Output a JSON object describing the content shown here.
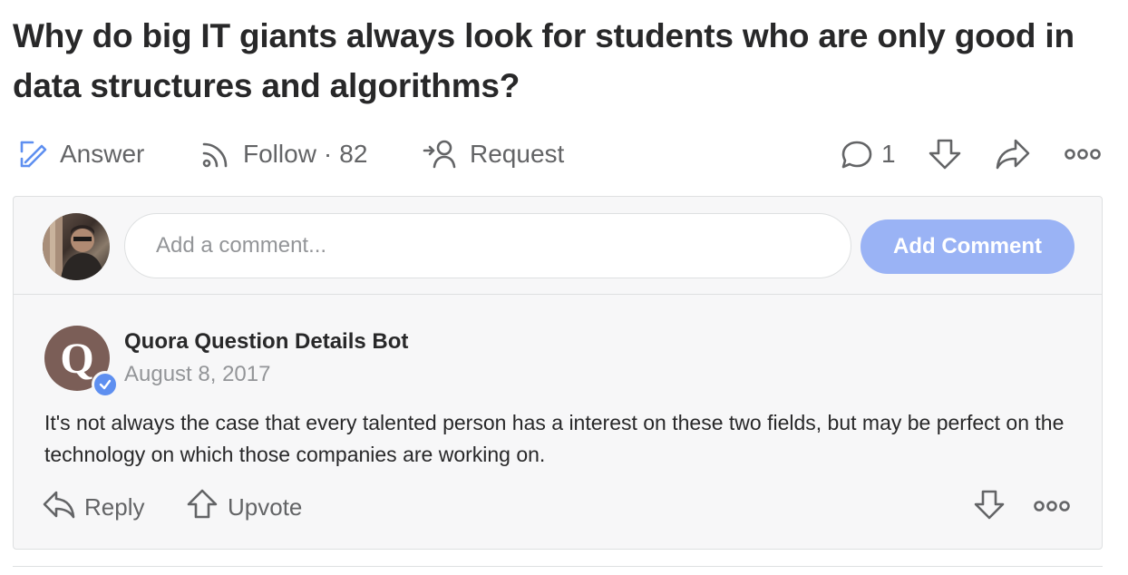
{
  "question": {
    "title": "Why do big IT giants always look for students who are only good in data structures and algorithms?"
  },
  "actions": {
    "answer_label": "Answer",
    "follow_label": "Follow",
    "follow_separator": "·",
    "follow_count": "82",
    "request_label": "Request",
    "comment_count": "1"
  },
  "composer": {
    "placeholder": "Add a comment...",
    "button_label": "Add Comment"
  },
  "comment": {
    "avatar_letter": "Q",
    "author": "Quora Question Details Bot",
    "date": "August 8, 2017",
    "text": "It's not always the case that every talented person has a interest on these two fields, but may be perfect on the technology on which those companies are working on.",
    "reply_label": "Reply",
    "upvote_label": "Upvote"
  },
  "colors": {
    "accent_blue": "#5e8ff0",
    "button_disabled": "#9ab3f5",
    "icon_gray": "#636466",
    "bot_avatar": "#7b5e57"
  },
  "icons": [
    "answer-pencil-icon",
    "follow-rss-icon",
    "request-person-icon",
    "comment-bubble-icon",
    "downvote-icon",
    "share-icon",
    "more-icon",
    "reply-icon",
    "upvote-icon"
  ]
}
